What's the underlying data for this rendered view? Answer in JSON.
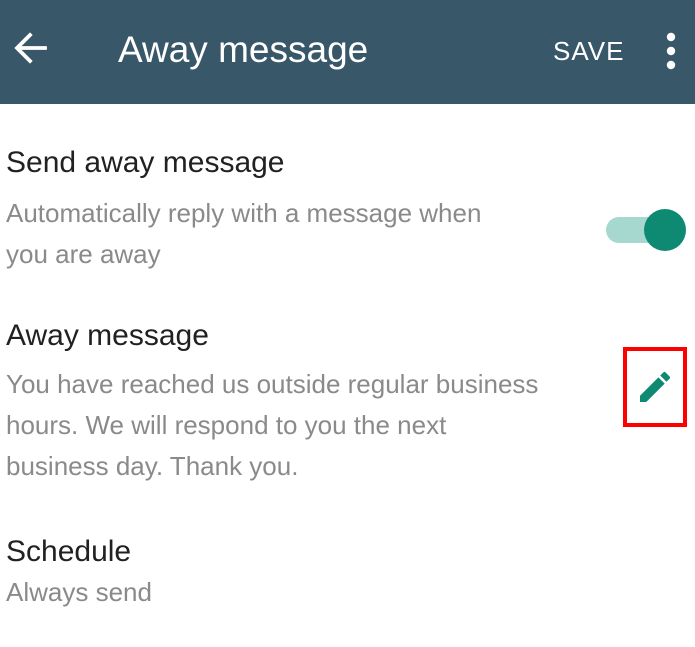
{
  "app_bar": {
    "back_icon": "arrow-back-icon",
    "title": "Away message",
    "save_label": "SAVE",
    "more_icon": "more-vert-icon"
  },
  "send_away": {
    "title": "Send away message",
    "subtitle_line1": "Automatically reply with a message when",
    "subtitle_line2": "you are away",
    "toggle_on": true
  },
  "away_message": {
    "title": "Away message",
    "text_line1": "You have reached us outside regular business",
    "text_line2": "hours. We will respond to you the next",
    "text_line3": "business day. Thank you.",
    "edit_icon": "pencil-icon"
  },
  "schedule": {
    "title": "Schedule",
    "value": "Always send"
  },
  "colors": {
    "app_bar": "#385869",
    "accent": "#0f8a72",
    "toggle_track": "#a7d8d0",
    "highlight": "#ff0000"
  }
}
